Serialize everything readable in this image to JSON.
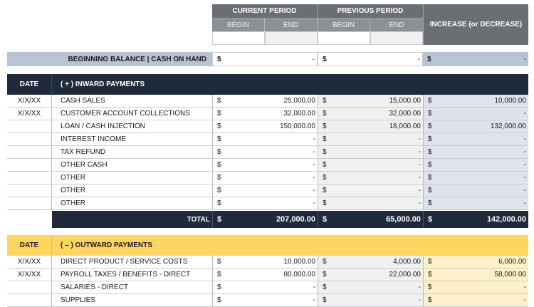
{
  "header": {
    "current_period": "CURRENT PERIOD",
    "previous_period": "PREVIOUS PERIOD",
    "begin": "BEGIN",
    "end": "END",
    "increase": "INCREASE (or DECREASE)"
  },
  "beginning_balance": {
    "label": "BEGINNING BALANCE  |  CASH ON HAND",
    "current": {
      "sym": "$",
      "val": "-"
    },
    "previous": {
      "sym": "$",
      "val": "-"
    },
    "change": {
      "sym": "$",
      "val": "-"
    }
  },
  "inward": {
    "date_header": "DATE",
    "title": "( + )  INWARD PAYMENTS",
    "rows": [
      {
        "date": "X/X/XX",
        "label": "CASH SALES",
        "current": "25,000.00",
        "previous": "15,000.00",
        "change": "10,000.00"
      },
      {
        "date": "X/X/XX",
        "label": "CUSTOMER ACCOUNT COLLECTIONS",
        "current": "32,000.00",
        "previous": "32,000.00",
        "change": "-"
      },
      {
        "date": "",
        "label": "LOAN / CASH INJECTION",
        "current": "150,000.00",
        "previous": "18,000.00",
        "change": "132,000.00"
      },
      {
        "date": "",
        "label": "INTEREST INCOME",
        "current": "-",
        "previous": "-",
        "change": "-"
      },
      {
        "date": "",
        "label": "TAX REFUND",
        "current": "-",
        "previous": "-",
        "change": "-"
      },
      {
        "date": "",
        "label": "OTHER CASH",
        "current": "-",
        "previous": "-",
        "change": "-"
      },
      {
        "date": "",
        "label": "OTHER",
        "current": "-",
        "previous": "-",
        "change": "-"
      },
      {
        "date": "",
        "label": "OTHER",
        "current": "-",
        "previous": "-",
        "change": "-"
      },
      {
        "date": "",
        "label": "OTHER",
        "current": "-",
        "previous": "-",
        "change": "-"
      }
    ],
    "total": {
      "label": "TOTAL",
      "current": "207,000.00",
      "previous": "65,000.00",
      "change": "142,000.00"
    }
  },
  "outward": {
    "date_header": "DATE",
    "title": "( – )  OUTWARD PAYMENTS",
    "rows": [
      {
        "date": "X/X/XX",
        "label": "DIRECT PRODUCT / SERVICE COSTS",
        "current": "10,000.00",
        "previous": "4,000.00",
        "change": "6,000.00"
      },
      {
        "date": "X/X/XX",
        "label": "PAYROLL TAXES / BENEFITS - DIRECT",
        "current": "80,000.00",
        "previous": "22,000.00",
        "change": "58,000.00"
      },
      {
        "date": "",
        "label": "SALARIES - DIRECT",
        "current": "-",
        "previous": "-",
        "change": "-"
      },
      {
        "date": "",
        "label": "SUPPLIES",
        "current": "-",
        "previous": "-",
        "change": "-"
      }
    ]
  },
  "currency_symbol": "$",
  "colors": {
    "header_gray": "#6b6e73",
    "navy": "#1f2a3a",
    "yellow": "#ffd562",
    "change_blue": "#dfe3ea",
    "change_yellow": "#fff1c7",
    "prev_gray": "#f0f0f0"
  }
}
